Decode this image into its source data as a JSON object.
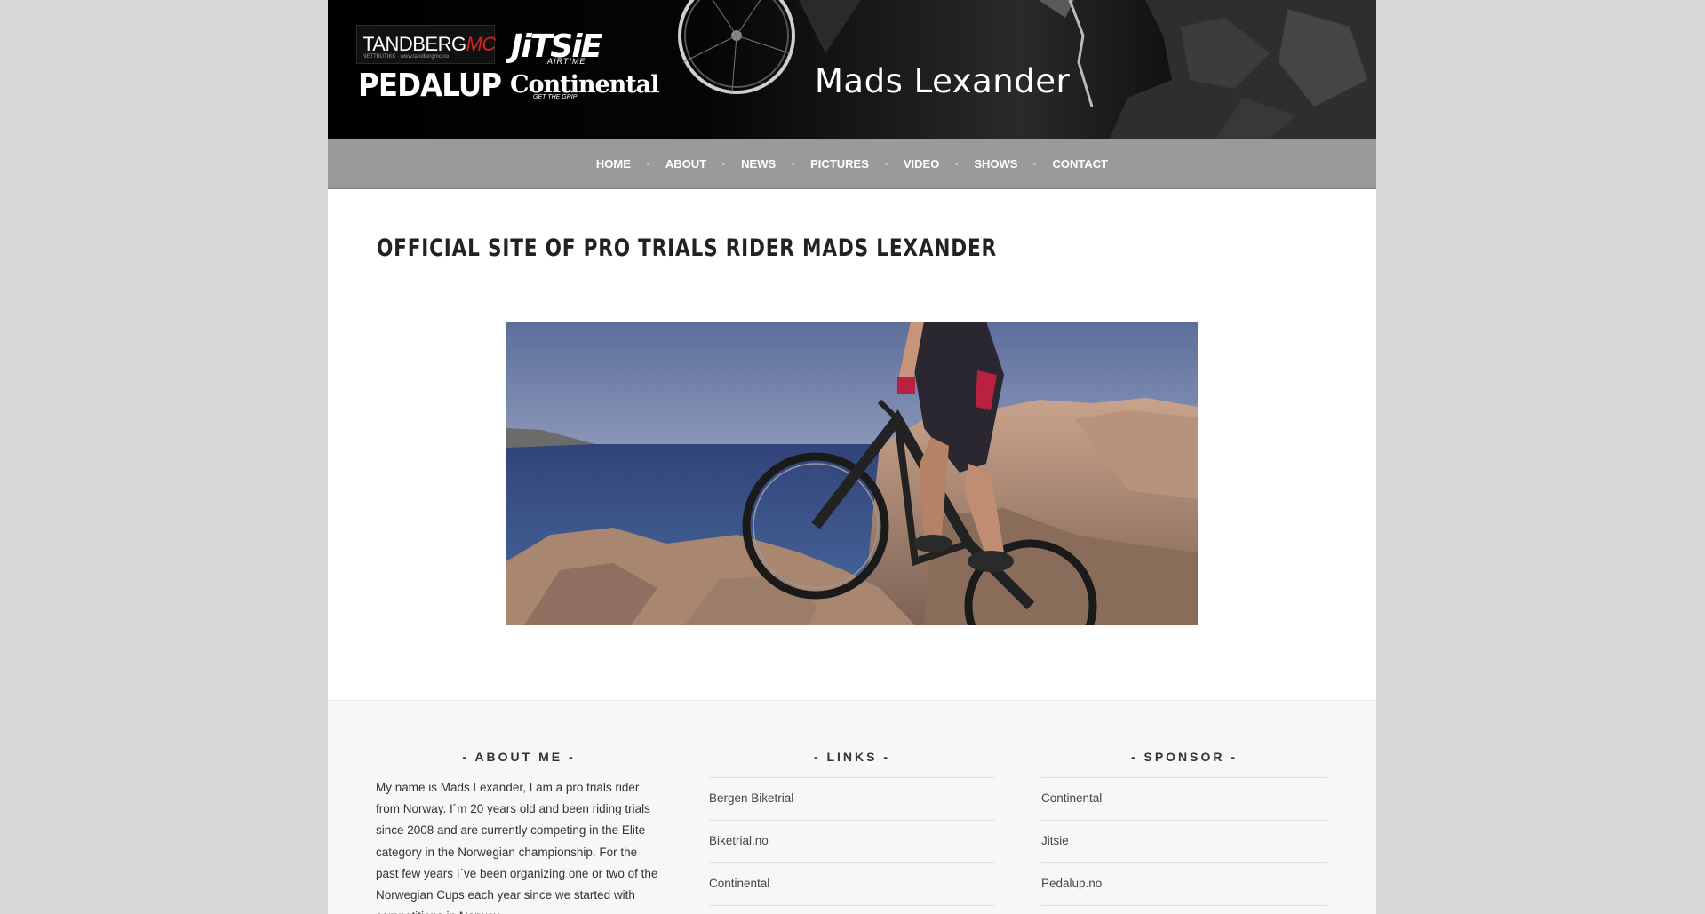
{
  "header": {
    "site_name": "Mads Lexander",
    "logos": {
      "tandberg_main": "TANDBERG",
      "tandberg_accent": "MC",
      "tandberg_sub": "NETTBUTIKK · www.tandbergmc.no",
      "pedalup": "PEDALUP",
      "jitsie": "JiTSiE",
      "airtime": "AIRTIME",
      "continental": "Continental",
      "continental_tag": "GET THE GRIP"
    }
  },
  "nav": {
    "items": [
      "HOME",
      "ABOUT",
      "NEWS",
      "PICTURES",
      "VIDEO",
      "SHOWS",
      "CONTACT"
    ]
  },
  "main": {
    "title": "OFFICIAL SITE OF PRO TRIALS RIDER MADS LEXANDER"
  },
  "footer": {
    "about": {
      "title": "- ABOUT ME -",
      "text": "My name is Mads Lexander, I am a pro trials rider from Norway. I´m 20 years old and been riding trials since 2008 and are currently competing in the Elite category in the Norwegian championship. For the past few years I´ve been organizing one or two of the Norwegian Cups each year since we started with competitions in Norway"
    },
    "links": {
      "title": "- LINKS -",
      "items": [
        "Bergen Biketrial",
        "Biketrial.no",
        "Continental"
      ]
    },
    "sponsor": {
      "title": "- SPONSOR -",
      "items": [
        "Continental",
        "Jitsie",
        "Pedalup.no"
      ]
    }
  },
  "colors": {
    "nav_bg": "#9a9a9a",
    "page_bg": "#d8d8d8",
    "footer_bg": "#f7f7f7",
    "accent_red": "#d6201f"
  }
}
